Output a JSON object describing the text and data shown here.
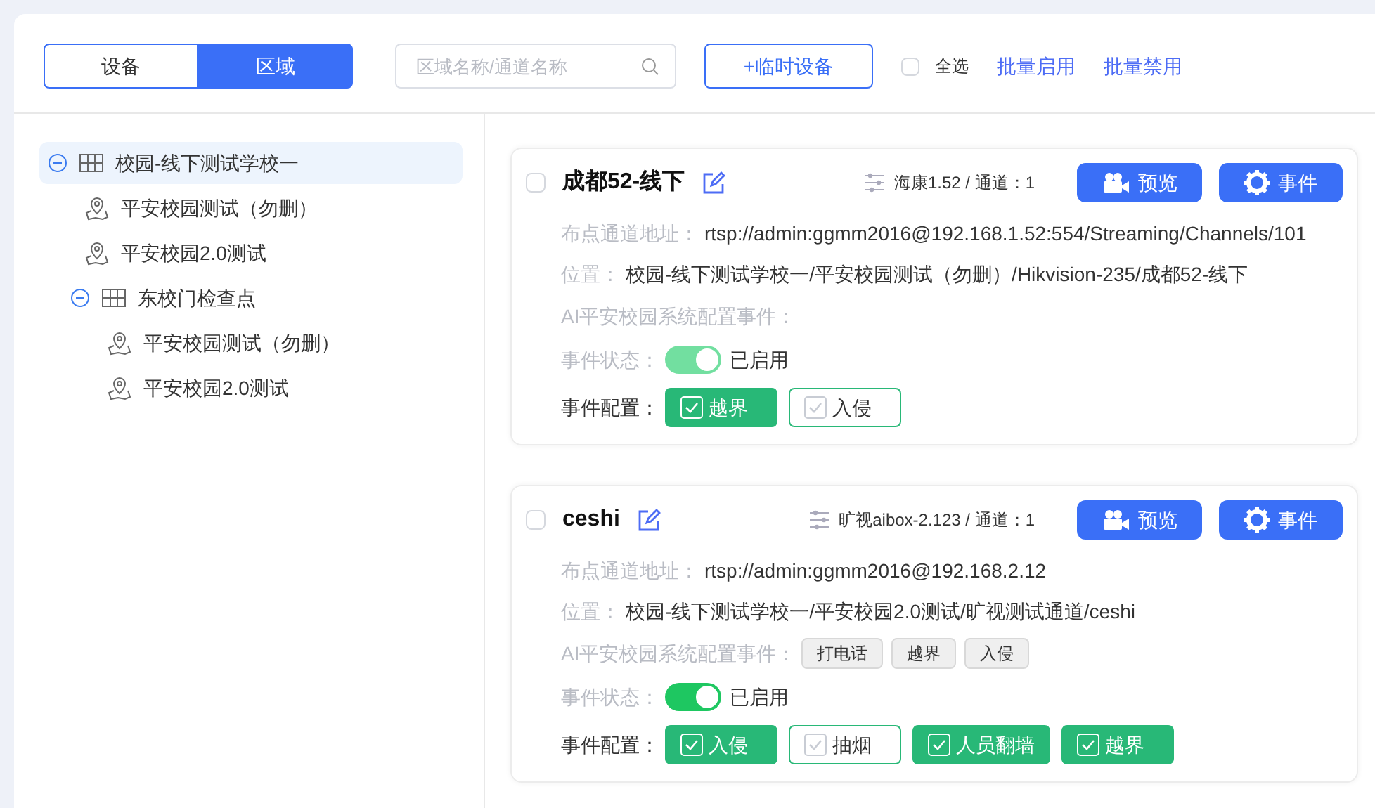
{
  "toolbar": {
    "tabs": [
      {
        "label": "设备",
        "selected": false
      },
      {
        "label": "区域",
        "selected": true
      }
    ],
    "search": {
      "placeholder": "区域名称/通道名称"
    },
    "add_button": "+临时设备",
    "select_all": {
      "label": "全选",
      "checked": false
    },
    "links": [
      "批量启用",
      "批量禁用"
    ]
  },
  "tree": [
    {
      "kind": "area",
      "label": "校园-线下测试学校一",
      "expanded": true,
      "selected": true,
      "children": [
        {
          "kind": "point",
          "label": "平安校园测试（勿删）",
          "selected": false
        },
        {
          "kind": "point",
          "label": "平安校园2.0测试",
          "selected": false
        },
        {
          "kind": "area",
          "label": "东校门检查点",
          "expanded": true,
          "selected": false,
          "children": [
            {
              "kind": "point",
              "label": "平安校园测试（勿删）",
              "selected": false
            },
            {
              "kind": "point",
              "label": "平安校园2.0测试",
              "selected": false
            }
          ]
        }
      ]
    }
  ],
  "cards": [
    {
      "checked": false,
      "name": "成都52-线下",
      "device": "海康1.52 / 通道：1",
      "preview": "预览",
      "events": "事件",
      "fields": [
        {
          "label": "布点通道地址：",
          "value": "rtsp://admin:ggmm2016@192.168.1.52:554/Streaming/Channels/101"
        },
        {
          "label": "位置：",
          "value": "校园-线下测试学校一/平安校园测试（勿删）/Hikvision-235/成都52-线下"
        }
      ],
      "ai_label": "AI平安校园系统配置事件：",
      "status_label": "事件状态：",
      "status": {
        "on": true,
        "disabled": true,
        "text": "已启用"
      },
      "config_label": "事件配置：",
      "config": [
        {
          "label": "越界",
          "checked": true
        },
        {
          "label": "入侵",
          "checked": false
        }
      ]
    },
    {
      "checked": false,
      "name": "ceshi",
      "device": "旷视aibox-2.123 / 通道：1",
      "preview": "预览",
      "events": "事件",
      "fields": [
        {
          "label": "布点通道地址：",
          "value": "rtsp://admin:ggmm2016@192.168.2.12"
        },
        {
          "label": "位置：",
          "value": "校园-线下测试学校一/平安校园2.0测试/旷视测试通道/ceshi"
        }
      ],
      "ai_label": "AI平安校园系统配置事件：",
      "ai_tags": [
        "打电话",
        "越界",
        "入侵"
      ],
      "status_label": "事件状态：",
      "status": {
        "on": true,
        "disabled": false,
        "text": "已启用"
      },
      "config_label": "事件配置：",
      "config": [
        {
          "label": "入侵",
          "checked": true
        },
        {
          "label": "抽烟",
          "checked": false
        },
        {
          "label": "人员翻墙",
          "checked": true
        },
        {
          "label": "越界",
          "checked": true
        }
      ]
    }
  ]
}
